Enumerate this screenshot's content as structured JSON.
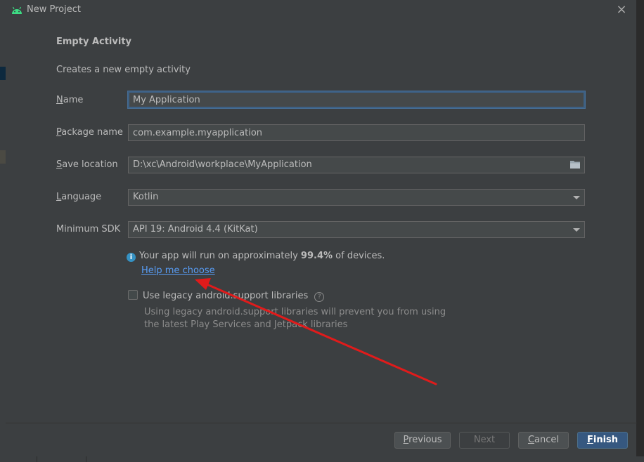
{
  "dialog": {
    "title": "New Project",
    "close_glyph": "×",
    "icon": "android-icon"
  },
  "template": {
    "heading": "Empty Activity",
    "description": "Creates a new empty activity"
  },
  "form": {
    "name": {
      "label_pre": "",
      "label_mn": "N",
      "label_post": "ame",
      "value": "My Application"
    },
    "package": {
      "label_pre": "",
      "label_mn": "P",
      "label_post": "ackage name",
      "value": "com.example.myapplication"
    },
    "save_location": {
      "label_pre": "",
      "label_mn": "S",
      "label_post": "ave location",
      "value": "D:\\xc\\Android\\workplace\\MyApplication",
      "icon": "folder-icon"
    },
    "language": {
      "label_pre": "",
      "label_mn": "L",
      "label_post": "anguage",
      "value": "Kotlin"
    },
    "min_sdk": {
      "label": "Minimum SDK",
      "value": "API 19: Android 4.4 (KitKat)"
    }
  },
  "info": {
    "icon": "info-icon",
    "text_before": "Your app will run on approximately ",
    "percent": "99.4%",
    "text_after": " of devices.",
    "help_link": "Help me choose"
  },
  "legacy": {
    "checked": false,
    "label": "Use legacy android.support libraries",
    "help_icon": "question-icon",
    "desc_line1": "Using legacy android.support libraries will prevent you from using",
    "desc_line2": "the latest Play Services and Jetpack libraries"
  },
  "buttons": {
    "previous_mn": "P",
    "previous_rest": "revious",
    "next": "Next",
    "cancel_mn": "C",
    "cancel_rest": "ancel",
    "finish_mn": "F",
    "finish_rest": "inish"
  },
  "colors": {
    "dialog_bg": "#3c3f41",
    "field_bg": "#45494a",
    "focus_border": "#3d6185",
    "link": "#589df6",
    "primary_button": "#365880",
    "annotation_arrow": "#e01b1b"
  }
}
